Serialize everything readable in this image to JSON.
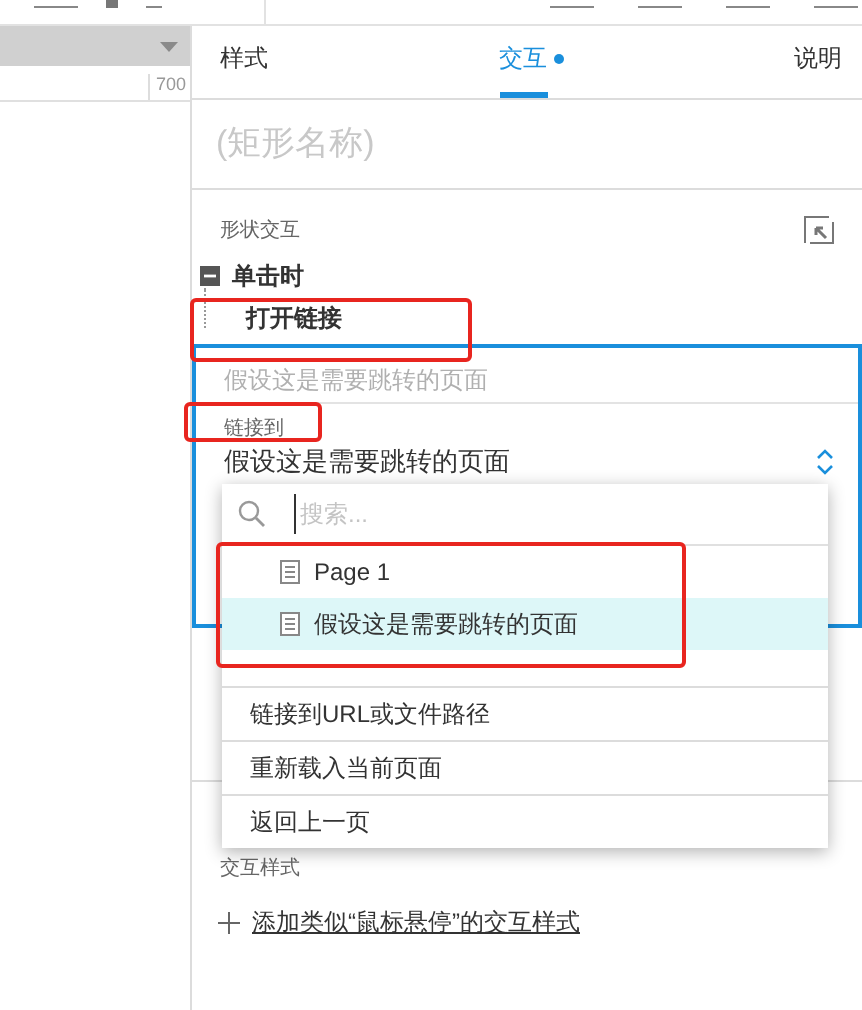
{
  "ruler": {
    "label": "700"
  },
  "tabs": [
    {
      "label": "样式",
      "selected": false,
      "dot": false
    },
    {
      "label": "交互",
      "selected": true,
      "dot": true
    },
    {
      "label": "说明",
      "selected": false,
      "dot": false
    }
  ],
  "name_field": {
    "placeholder": "(矩形名称)"
  },
  "section_title": "形状交互",
  "event": {
    "label": "单击时",
    "expanded": true,
    "actions": [
      {
        "label": "打开链接"
      }
    ]
  },
  "action_editor": {
    "target_placeholder": "假设这是需要跳转的页面",
    "link_label": "链接到",
    "link_value": "假设这是需要跳转的页面"
  },
  "dropdown": {
    "search_placeholder": "搜索...",
    "pages": [
      {
        "label": "Page 1",
        "selected": false
      },
      {
        "label": "假设这是需要跳转的页面",
        "selected": true
      }
    ],
    "options": [
      "链接到URL或文件路径",
      "重新载入当前页面",
      "返回上一页"
    ]
  },
  "interaction_styles": {
    "title": "交互样式",
    "add_link": "添加类似“鼠标悬停”的交互样式"
  }
}
